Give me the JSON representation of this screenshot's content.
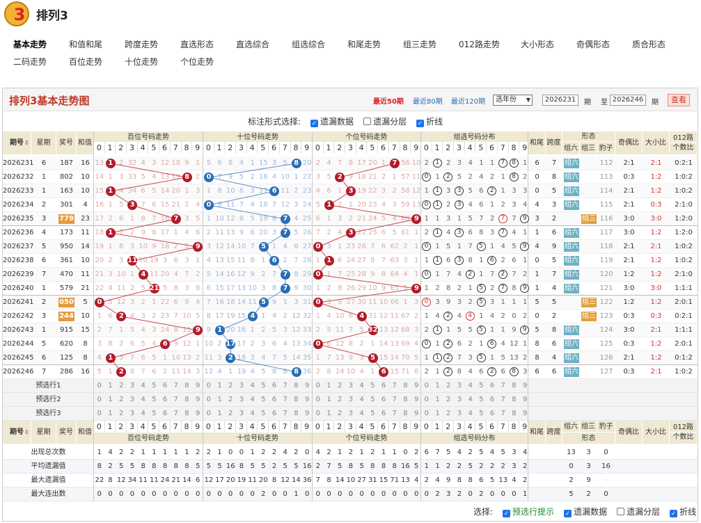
{
  "app": {
    "name": "排列3",
    "logo_text": "3"
  },
  "nav": {
    "row1": [
      "基本走势",
      "和值和尾",
      "跨度走势",
      "直选形态",
      "直选综合",
      "组选综合",
      "和尾走势",
      "组三走势",
      "012路走势",
      "大小形态",
      "奇偶形态",
      "质合形态"
    ],
    "row2": [
      "二码走势",
      "百位走势",
      "十位走势",
      "个位走势"
    ],
    "active": "基本走势"
  },
  "panel": {
    "title": "排列3基本走势图",
    "link_50": "最近50期",
    "link_80": "最近80期",
    "link_120": "最近120期",
    "year_select": "选年份",
    "period_from": "2026231",
    "period_label": "期",
    "to_label": "至",
    "period_to": "2026246",
    "query_btn": "查看"
  },
  "options": {
    "label": "标注形式选择:",
    "items": [
      {
        "label": "遗漏数据",
        "checked": true
      },
      {
        "label": "遗漏分层",
        "checked": false
      },
      {
        "label": "折线",
        "checked": true
      }
    ]
  },
  "headers": {
    "issue": "期号",
    "week": "星期",
    "prize": "奖号",
    "sum": "和值",
    "bai": "百位号码走势",
    "shi": "十位号码走势",
    "ge": "个位号码走势",
    "zx": "组选号码分布",
    "hw": "和尾",
    "kd": "跨度",
    "xt": "形态",
    "z6": "组六",
    "z3": "组三",
    "bz": "豹子",
    "jo": "奇偶比",
    "dx": "大小比",
    "l012a": "012路",
    "l012b": "个数比"
  },
  "digits": [
    "0",
    "1",
    "2",
    "3",
    "4",
    "5",
    "6",
    "7",
    "8",
    "9"
  ],
  "colors": {
    "bai": "#b11c2a",
    "shi": "#2a6db4",
    "ge": "#b11c2a",
    "header": "#efe8d2",
    "z6": "#6fb1c4",
    "z3": "#e0a23e"
  },
  "rows": [
    {
      "issue": "2026231",
      "week": "6",
      "prize": "187",
      "sum": "16",
      "hl": false,
      "hw": "6",
      "kd": "7",
      "form": "组六",
      "bz": "112",
      "jo": "2:1",
      "dx": "2:1",
      "r012": "0:2:1",
      "bai": [
        "13",
        "1",
        "2",
        "32",
        "4",
        "3",
        "12",
        "18",
        "9",
        "1"
      ],
      "shi": [
        "5",
        "6",
        "8",
        "4",
        "1",
        "15",
        "3",
        "5",
        "8",
        "20"
      ],
      "ge": [
        "2",
        "4",
        "7",
        "8",
        "17",
        "20",
        "1",
        "7",
        "56",
        "10"
      ],
      "zx": [
        "2",
        "1",
        "2",
        "3",
        "4",
        "1",
        "1",
        "7",
        "8",
        "1"
      ]
    },
    {
      "issue": "2026232",
      "week": "1",
      "prize": "802",
      "sum": "10",
      "hl": false,
      "hw": "0",
      "kd": "8",
      "form": "组六",
      "bz": "113",
      "jo": "0:3",
      "dx": "1:2",
      "r012": "1:0:2",
      "bai": [
        "14",
        "1",
        "3",
        "33",
        "5",
        "4",
        "13",
        "19",
        "8",
        "2"
      ],
      "shi": [
        "0",
        "7",
        "9",
        "5",
        "2",
        "16",
        "4",
        "10",
        "1",
        "22"
      ],
      "ge": [
        "3",
        "5",
        "2",
        "9",
        "18",
        "21",
        "2",
        "1",
        "57",
        "11"
      ],
      "zx": [
        "0",
        "1",
        "2",
        "5",
        "2",
        "4",
        "2",
        "1",
        "8",
        "2"
      ]
    },
    {
      "issue": "2026233",
      "week": "1",
      "prize": "163",
      "sum": "10",
      "hl": false,
      "hw": "0",
      "kd": "5",
      "form": "组六",
      "bz": "114",
      "jo": "2:1",
      "dx": "1:2",
      "r012": "1:0:2",
      "bai": [
        "15",
        "1",
        "4",
        "34",
        "6",
        "5",
        "14",
        "20",
        "1",
        "3"
      ],
      "shi": [
        "1",
        "8",
        "10",
        "6",
        "3",
        "17",
        "6",
        "11",
        "2",
        "23"
      ],
      "ge": [
        "4",
        "6",
        "1",
        "3",
        "19",
        "22",
        "3",
        "2",
        "58",
        "12"
      ],
      "zx": [
        "1",
        "1",
        "3",
        "3",
        "5",
        "6",
        "2",
        "1",
        "3",
        "3"
      ]
    },
    {
      "issue": "2026234",
      "week": "2",
      "prize": "301",
      "sum": "4",
      "hl": false,
      "hw": "4",
      "kd": "3",
      "form": "组六",
      "bz": "115",
      "jo": "2:1",
      "dx": "0:3",
      "r012": "2:1:0",
      "bai": [
        "16",
        "1",
        "5",
        "3",
        "7",
        "6",
        "15",
        "21",
        "2",
        "4"
      ],
      "shi": [
        "0",
        "9",
        "11",
        "7",
        "4",
        "18",
        "7",
        "12",
        "3",
        "24"
      ],
      "ge": [
        "5",
        "1",
        "2",
        "1",
        "20",
        "23",
        "4",
        "3",
        "59",
        "13"
      ],
      "zx": [
        "0",
        "1",
        "2",
        "3",
        "4",
        "6",
        "1",
        "2",
        "3",
        "4"
      ]
    },
    {
      "issue": "2026235",
      "week": "3",
      "prize": "779",
      "sum": "23",
      "hl": true,
      "hw": "3",
      "kd": "2",
      "form": "组三",
      "bz": "116",
      "jo": "3:0",
      "dx": "3:0",
      "r012": "1:2:0",
      "bai": [
        "17",
        "2",
        "6",
        "1",
        "8",
        "7",
        "16",
        "7",
        "3",
        "5"
      ],
      "shi": [
        "1",
        "10",
        "12",
        "8",
        "5",
        "19",
        "8",
        "7",
        "4",
        "25"
      ],
      "ge": [
        "6",
        "1",
        "3",
        "2",
        "21",
        "24",
        "5",
        "4",
        "60",
        "9"
      ],
      "zx": [
        "1",
        "1",
        "3",
        "1",
        "5",
        "7",
        "2",
        "7",
        "7",
        "9"
      ]
    },
    {
      "issue": "2026236",
      "week": "4",
      "prize": "173",
      "sum": "11",
      "hl": false,
      "hw": "1",
      "kd": "6",
      "form": "组六",
      "bz": "117",
      "jo": "3:0",
      "dx": "1:2",
      "r012": "1:2:0",
      "bai": [
        "18",
        "1",
        "7",
        "2",
        "9",
        "8",
        "17",
        "1",
        "4",
        "6"
      ],
      "shi": [
        "2",
        "11",
        "13",
        "9",
        "6",
        "20",
        "3",
        "7",
        "5",
        "26"
      ],
      "ge": [
        "7",
        "2",
        "4",
        "3",
        "22",
        "25",
        "6",
        "5",
        "61",
        "1"
      ],
      "zx": [
        "2",
        "1",
        "4",
        "3",
        "6",
        "8",
        "3",
        "7",
        "4",
        "1"
      ]
    },
    {
      "issue": "2026237",
      "week": "5",
      "prize": "950",
      "sum": "14",
      "hl": false,
      "hw": "4",
      "kd": "9",
      "form": "组六",
      "bz": "118",
      "jo": "2:1",
      "dx": "2:1",
      "r012": "1:0:2",
      "bai": [
        "19",
        "1",
        "8",
        "3",
        "10",
        "9",
        "18",
        "2",
        "5",
        "9"
      ],
      "shi": [
        "3",
        "12",
        "14",
        "10",
        "7",
        "5",
        "1",
        "4",
        "6",
        "27"
      ],
      "ge": [
        "0",
        "3",
        "1",
        "23",
        "26",
        "7",
        "6",
        "62",
        "2",
        "1"
      ],
      "zx": [
        "0",
        "1",
        "5",
        "1",
        "7",
        "5",
        "1",
        "4",
        "5",
        "9"
      ]
    },
    {
      "issue": "2026238",
      "week": "6",
      "prize": "361",
      "sum": "10",
      "hl": false,
      "hw": "0",
      "kd": "5",
      "form": "组六",
      "bz": "119",
      "jo": "2:1",
      "dx": "1:2",
      "r012": "1:0:2",
      "bai": [
        "20",
        "2",
        "3",
        "11",
        "10",
        "19",
        "3",
        "6",
        "3",
        "1"
      ],
      "shi": [
        "4",
        "13",
        "15",
        "11",
        "8",
        "1",
        "6",
        "2",
        "7",
        "28"
      ],
      "ge": [
        "1",
        "1",
        "6",
        "24",
        "27",
        "8",
        "7",
        "63",
        "3",
        "1"
      ],
      "zx": [
        "1",
        "1",
        "6",
        "3",
        "8",
        "1",
        "6",
        "2",
        "6",
        "1"
      ]
    },
    {
      "issue": "2026239",
      "week": "7",
      "prize": "470",
      "sum": "11",
      "hl": false,
      "hw": "1",
      "kd": "7",
      "form": "组六",
      "bz": "120",
      "jo": "1:2",
      "dx": "1:2",
      "r012": "2:1:0",
      "bai": [
        "21",
        "3",
        "10",
        "1",
        "4",
        "11",
        "20",
        "4",
        "7",
        "2"
      ],
      "shi": [
        "5",
        "14",
        "16",
        "12",
        "9",
        "2",
        "7",
        "7",
        "8",
        "29"
      ],
      "ge": [
        "0",
        "1",
        "7",
        "25",
        "28",
        "9",
        "8",
        "64",
        "4",
        "1"
      ],
      "zx": [
        "0",
        "1",
        "7",
        "4",
        "2",
        "1",
        "7",
        "2",
        "7",
        "2"
      ]
    },
    {
      "issue": "2026240",
      "week": "1",
      "prize": "579",
      "sum": "21",
      "hl": false,
      "hw": "1",
      "kd": "4",
      "form": "组六",
      "bz": "121",
      "jo": "3:0",
      "dx": "3:0",
      "r012": "1:1:1",
      "bai": [
        "22",
        "4",
        "11",
        "2",
        "5",
        "21",
        "5",
        "8",
        "3",
        "8"
      ],
      "shi": [
        "6",
        "15",
        "17",
        "13",
        "10",
        "3",
        "8",
        "7",
        "9",
        "30"
      ],
      "ge": [
        "1",
        "2",
        "8",
        "26",
        "29",
        "10",
        "9",
        "65",
        "5",
        "9"
      ],
      "zx": [
        "1",
        "2",
        "8",
        "2",
        "1",
        "5",
        "2",
        "7",
        "8",
        "9"
      ]
    },
    {
      "issue": "2026241",
      "week": "2",
      "prize": "050",
      "sum": "5",
      "hl": true,
      "hw": "5",
      "kd": "5",
      "form": "组三",
      "bz": "122",
      "jo": "1:2",
      "dx": "1:2",
      "r012": "2:0:1",
      "bai": [
        "0",
        "5",
        "12",
        "3",
        "2",
        "1",
        "22",
        "6",
        "9",
        "4"
      ],
      "shi": [
        "7",
        "16",
        "18",
        "14",
        "11",
        "5",
        "9",
        "1",
        "3",
        "31"
      ],
      "ge": [
        "0",
        "3",
        "9",
        "27",
        "30",
        "11",
        "10",
        "66",
        "1",
        "3"
      ],
      "zx": [
        "0",
        "3",
        "9",
        "3",
        "2",
        "5",
        "3",
        "1",
        "1",
        "1"
      ]
    },
    {
      "issue": "2026242",
      "week": "3",
      "prize": "244",
      "sum": "10",
      "hl": true,
      "hw": "0",
      "kd": "2",
      "form": "组三",
      "bz": "123",
      "jo": "0:3",
      "dx": "0:3",
      "r012": "0:2:1",
      "bai": [
        "1",
        "6",
        "2",
        "4",
        "3",
        "2",
        "23",
        "7",
        "10",
        "5"
      ],
      "shi": [
        "8",
        "17",
        "19",
        "15",
        "4",
        "1",
        "4",
        "2",
        "12",
        "32"
      ],
      "ge": [
        "1",
        "4",
        "10",
        "6",
        "4",
        "31",
        "12",
        "11",
        "67",
        "2"
      ],
      "zx": [
        "1",
        "4",
        "2",
        "4",
        "4",
        "1",
        "4",
        "2",
        "0",
        "2"
      ]
    },
    {
      "issue": "2026243",
      "week": "1",
      "prize": "915",
      "sum": "15",
      "hl": false,
      "hw": "5",
      "kd": "8",
      "form": "组六",
      "bz": "124",
      "jo": "3:0",
      "dx": "2:1",
      "r012": "1:1:1",
      "bai": [
        "2",
        "7",
        "1",
        "5",
        "4",
        "3",
        "24",
        "8",
        "11",
        "9"
      ],
      "shi": [
        "9",
        "1",
        "20",
        "16",
        "1",
        "2",
        "5",
        "3",
        "12",
        "33"
      ],
      "ge": [
        "2",
        "5",
        "11",
        "7",
        "5",
        "32",
        "13",
        "12",
        "68",
        "3"
      ],
      "zx": [
        "2",
        "1",
        "1",
        "5",
        "5",
        "5",
        "1",
        "1",
        "9",
        "9"
      ]
    },
    {
      "issue": "2026244",
      "week": "5",
      "prize": "620",
      "sum": "8",
      "hl": false,
      "hw": "8",
      "kd": "6",
      "form": "组六",
      "bz": "125",
      "jo": "0:3",
      "dx": "1:2",
      "r012": "2:0:1",
      "bai": [
        "3",
        "8",
        "2",
        "6",
        "5",
        "4",
        "6",
        "9",
        "12",
        "1"
      ],
      "shi": [
        "10",
        "2",
        "17",
        "17",
        "2",
        "3",
        "6",
        "4",
        "13",
        "34"
      ],
      "ge": [
        "0",
        "6",
        "12",
        "8",
        "2",
        "1",
        "14",
        "13",
        "69",
        "4"
      ],
      "zx": [
        "0",
        "1",
        "2",
        "6",
        "2",
        "1",
        "6",
        "4",
        "12",
        "1"
      ]
    },
    {
      "issue": "2026245",
      "week": "6",
      "prize": "125",
      "sum": "8",
      "hl": false,
      "hw": "8",
      "kd": "4",
      "form": "组六",
      "bz": "126",
      "jo": "2:1",
      "dx": "1:2",
      "r012": "0:1:2",
      "bai": [
        "4",
        "1",
        "3",
        "7",
        "6",
        "5",
        "1",
        "10",
        "13",
        "2"
      ],
      "shi": [
        "11",
        "3",
        "2",
        "18",
        "3",
        "4",
        "7",
        "5",
        "14",
        "35"
      ],
      "ge": [
        "1",
        "7",
        "13",
        "9",
        "3",
        "5",
        "15",
        "14",
        "70",
        "5"
      ],
      "zx": [
        "1",
        "1",
        "2",
        "7",
        "3",
        "5",
        "1",
        "5",
        "13",
        "2"
      ]
    },
    {
      "issue": "2026246",
      "week": "7",
      "prize": "286",
      "sum": "16",
      "hl": false,
      "hw": "6",
      "kd": "6",
      "form": "组六",
      "bz": "127",
      "jo": "0:3",
      "dx": "2:1",
      "r012": "1:0:2",
      "bai": [
        "5",
        "1",
        "2",
        "8",
        "7",
        "6",
        "2",
        "11",
        "14",
        "3"
      ],
      "shi": [
        "12",
        "4",
        "1",
        "19",
        "4",
        "5",
        "8",
        "6",
        "8",
        "36"
      ],
      "ge": [
        "2",
        "8",
        "14",
        "10",
        "4",
        "1",
        "6",
        "15",
        "71",
        "6"
      ],
      "zx": [
        "2",
        "1",
        "2",
        "8",
        "4",
        "6",
        "2",
        "6",
        "8",
        "3"
      ]
    }
  ],
  "preselect": [
    "预选行1",
    "预选行2",
    "预选行3"
  ],
  "stats": [
    {
      "label": "出现总次数",
      "bai": [
        "1",
        "4",
        "2",
        "2",
        "1",
        "1",
        "1",
        "1",
        "1",
        "2"
      ],
      "shi": [
        "2",
        "1",
        "0",
        "0",
        "1",
        "2",
        "2",
        "4",
        "2",
        "0"
      ],
      "ge": [
        "4",
        "2",
        "1",
        "2",
        "1",
        "2",
        "1",
        "1",
        "0",
        "2"
      ],
      "zx": [
        "6",
        "7",
        "5",
        "4",
        "2",
        "5",
        "4",
        "5",
        "3",
        "4"
      ],
      "z": [
        "13",
        "3",
        "0"
      ]
    },
    {
      "label": "平均遗漏值",
      "bai": [
        "8",
        "2",
        "5",
        "5",
        "8",
        "8",
        "8",
        "8",
        "8",
        "5"
      ],
      "shi": [
        "5",
        "5",
        "16",
        "8",
        "5",
        "5",
        "2",
        "5",
        "5",
        "16"
      ],
      "ge": [
        "2",
        "7",
        "5",
        "8",
        "5",
        "8",
        "8",
        "8",
        "16",
        "5"
      ],
      "zx": [
        "1",
        "1",
        "2",
        "2",
        "5",
        "2",
        "2",
        "2",
        "3",
        "2"
      ],
      "z": [
        "0",
        "3",
        "16"
      ]
    },
    {
      "label": "最大遗漏值",
      "bai": [
        "22",
        "8",
        "12",
        "34",
        "11",
        "11",
        "24",
        "21",
        "14",
        "6"
      ],
      "shi": [
        "12",
        "17",
        "20",
        "19",
        "11",
        "20",
        "8",
        "12",
        "14",
        "36"
      ],
      "ge": [
        "7",
        "8",
        "14",
        "10",
        "27",
        "31",
        "15",
        "71",
        "13",
        "4"
      ],
      "zx": [
        "2",
        "4",
        "9",
        "8",
        "8",
        "6",
        "5",
        "13",
        "4",
        "2"
      ],
      "z": [
        "2",
        "9",
        "-"
      ]
    },
    {
      "label": "最大连出数",
      "bai": [
        "0",
        "0",
        "0",
        "0",
        "0",
        "0",
        "0",
        "0",
        "0",
        "0"
      ],
      "shi": [
        "0",
        "0",
        "0",
        "0",
        "0",
        "2",
        "0",
        "0",
        "1",
        "0"
      ],
      "ge": [
        "0",
        "0",
        "0",
        "0",
        "0",
        "0",
        "0",
        "0",
        "0",
        "0"
      ],
      "zx": [
        "0",
        "2",
        "3",
        "2",
        "0",
        "2",
        "0",
        "0",
        "0",
        "1"
      ],
      "z": [
        "5",
        "2",
        "0"
      ]
    }
  ],
  "footer": {
    "label": "选择:",
    "items": [
      {
        "label": "预选行提示",
        "checked": true,
        "green": true
      },
      {
        "label": "遗漏数据",
        "checked": true
      },
      {
        "label": "遗漏分层",
        "checked": false
      },
      {
        "label": "折线",
        "checked": true
      }
    ]
  }
}
